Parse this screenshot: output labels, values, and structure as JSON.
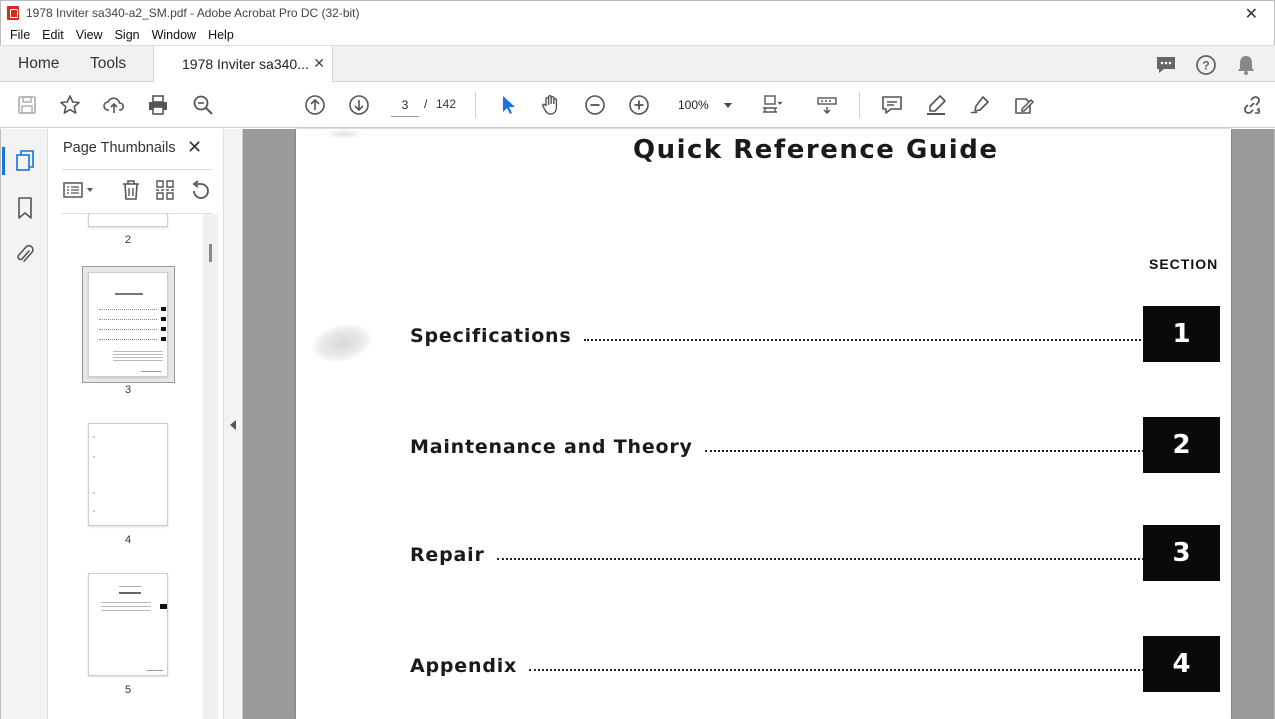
{
  "window": {
    "title": "1978 Inviter sa340-a2_SM.pdf - Adobe Acrobat Pro DC (32-bit)"
  },
  "menu": [
    "File",
    "Edit",
    "View",
    "Sign",
    "Window",
    "Help"
  ],
  "tabs": {
    "home": "Home",
    "tools": "Tools",
    "document": "1978 Inviter sa340..."
  },
  "toolbar": {
    "current_page": "3",
    "page_sep": "/",
    "total_pages": "142",
    "zoom": "100%"
  },
  "thumbnails": {
    "title": "Page Thumbnails",
    "pages": [
      {
        "label": "2"
      },
      {
        "label": "3",
        "selected": true
      },
      {
        "label": "4"
      },
      {
        "label": "5"
      }
    ]
  },
  "document": {
    "title": "Quick Reference Guide",
    "section_header": "SECTION",
    "entries": [
      {
        "name": "Specifications",
        "section": "1"
      },
      {
        "name": "Maintenance and Theory",
        "section": "2"
      },
      {
        "name": "Repair",
        "section": "3"
      },
      {
        "name": "Appendix",
        "section": "4"
      }
    ]
  },
  "colors": {
    "accent": "#1473e6",
    "pdf_red": "#d62a1e",
    "canvas_gray": "#9a9a9a"
  }
}
